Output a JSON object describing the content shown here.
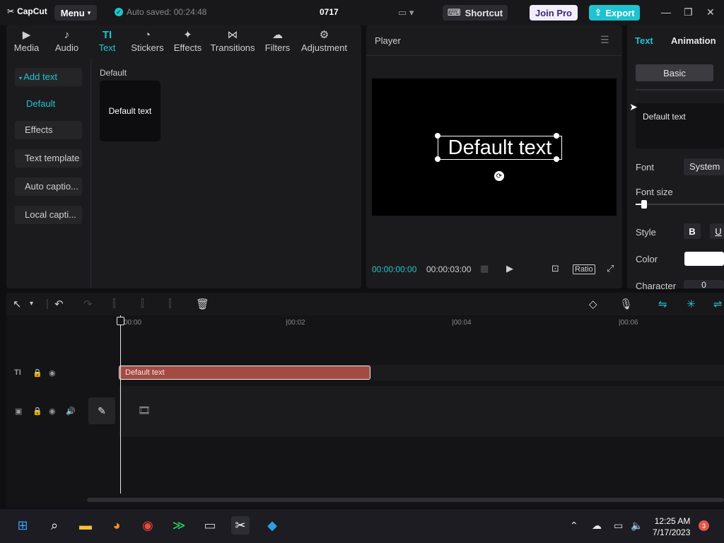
{
  "app": {
    "logo": "CapCut",
    "menu_label": "Menu",
    "autosave": "Auto saved: 00:24:48",
    "project_title": "0717",
    "shortcut_label": "Shortcut",
    "joinpro_label": "Join Pro",
    "export_label": "Export"
  },
  "media_tabs": [
    {
      "label": "Media",
      "icon": "media-icon"
    },
    {
      "label": "Audio",
      "icon": "audio-icon"
    },
    {
      "label": "Text",
      "icon": "text-icon"
    },
    {
      "label": "Stickers",
      "icon": "stickers-icon"
    },
    {
      "label": "Effects",
      "icon": "effects-icon"
    },
    {
      "label": "Transitions",
      "icon": "transitions-icon"
    },
    {
      "label": "Filters",
      "icon": "filters-icon"
    },
    {
      "label": "Adjustment",
      "icon": "adjustment-icon"
    }
  ],
  "sidebar": {
    "add_text": "Add text",
    "default": "Default",
    "effects": "Effects",
    "text_template": "Text template",
    "auto_caption": "Auto captio...",
    "local_caption": "Local capti..."
  },
  "library": {
    "section_title": "Default",
    "card_label": "Default text"
  },
  "player": {
    "title": "Player",
    "canvas_text": "Default text",
    "current_time": "00:00:00:00",
    "total_time": "00:00:03:00",
    "ratio_label": "Ratio"
  },
  "props": {
    "tab_text": "Text",
    "tab_animation": "Animation",
    "basic_label": "Basic",
    "text_value": "Default text",
    "font_label": "Font",
    "font_value": "System",
    "font_size_label": "Font size",
    "style_label": "Style",
    "bold_label": "B",
    "underline_label": "U",
    "color_label": "Color",
    "color_value": "#ffffff",
    "character_label": "Character",
    "character_value": "0"
  },
  "timeline": {
    "ticks": [
      "00:00",
      "|00:02",
      "|00:04",
      "|00:06"
    ],
    "clip_label": "Default text"
  },
  "taskbar": {
    "time": "12:25 AM",
    "date": "7/17/2023",
    "notification_count": "3"
  },
  "colors": {
    "accent": "#22c3cc",
    "clip": "#a34b42",
    "join_pro_bg": "#f2eef9"
  }
}
